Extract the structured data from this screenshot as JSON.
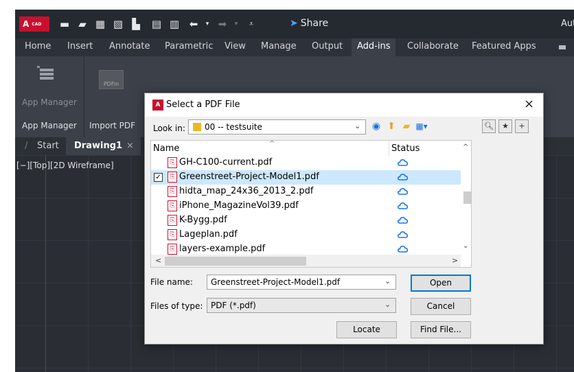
{
  "app": {
    "logo_text": "A",
    "logo_sub": "CAD",
    "share_label": "Share",
    "title_partial": "Auto"
  },
  "ribbon_tabs": [
    {
      "label": "Home"
    },
    {
      "label": "Insert"
    },
    {
      "label": "Annotate"
    },
    {
      "label": "Parametric"
    },
    {
      "label": "View"
    },
    {
      "label": "Manage"
    },
    {
      "label": "Output"
    },
    {
      "label": "Add-ins",
      "active": true
    },
    {
      "label": "Collaborate"
    },
    {
      "label": "Featured Apps"
    }
  ],
  "ribbon": {
    "app_manager_button": "App Manager",
    "pdf_import_button": "PDFin",
    "panels": [
      "App Manager",
      "Import PDF"
    ]
  },
  "doc_tabs": {
    "start": "Start",
    "drawing": "Drawing1",
    "close": "×"
  },
  "viewport": {
    "label": "[−][Top][2D Wireframe]"
  },
  "dialog": {
    "icon_text": "A",
    "title": "Select a PDF File",
    "close": "×",
    "look_in_label": "Look in:",
    "look_in_value": "00 -- testsuite",
    "columns": {
      "name": "Name",
      "status": "Status"
    },
    "files": [
      {
        "name": "GH-C100-current.pdf",
        "selected": false
      },
      {
        "name": "Greenstreet-Project-Model1.pdf",
        "selected": true
      },
      {
        "name": "hidta_map_24x36_2013_2.pdf",
        "selected": false
      },
      {
        "name": "iPhone_MagazineVol39.pdf",
        "selected": false
      },
      {
        "name": "K-Bygg.pdf",
        "selected": false
      },
      {
        "name": "Lageplan.pdf",
        "selected": false
      },
      {
        "name": "layers-example.pdf",
        "selected": false
      }
    ],
    "file_name_label": "File name:",
    "file_name_value": "Greenstreet-Project-Model1.pdf",
    "files_of_type_label": "Files of type:",
    "files_of_type_value": "PDF (*.pdf)",
    "buttons": {
      "open": "Open",
      "cancel": "Cancel",
      "locate": "Locate",
      "find_file": "Find File..."
    }
  },
  "colors": {
    "accent": "#0078d7",
    "brand_red": "#c8102e",
    "selection": "#cce8ff",
    "cloud": "#1a73e8"
  }
}
